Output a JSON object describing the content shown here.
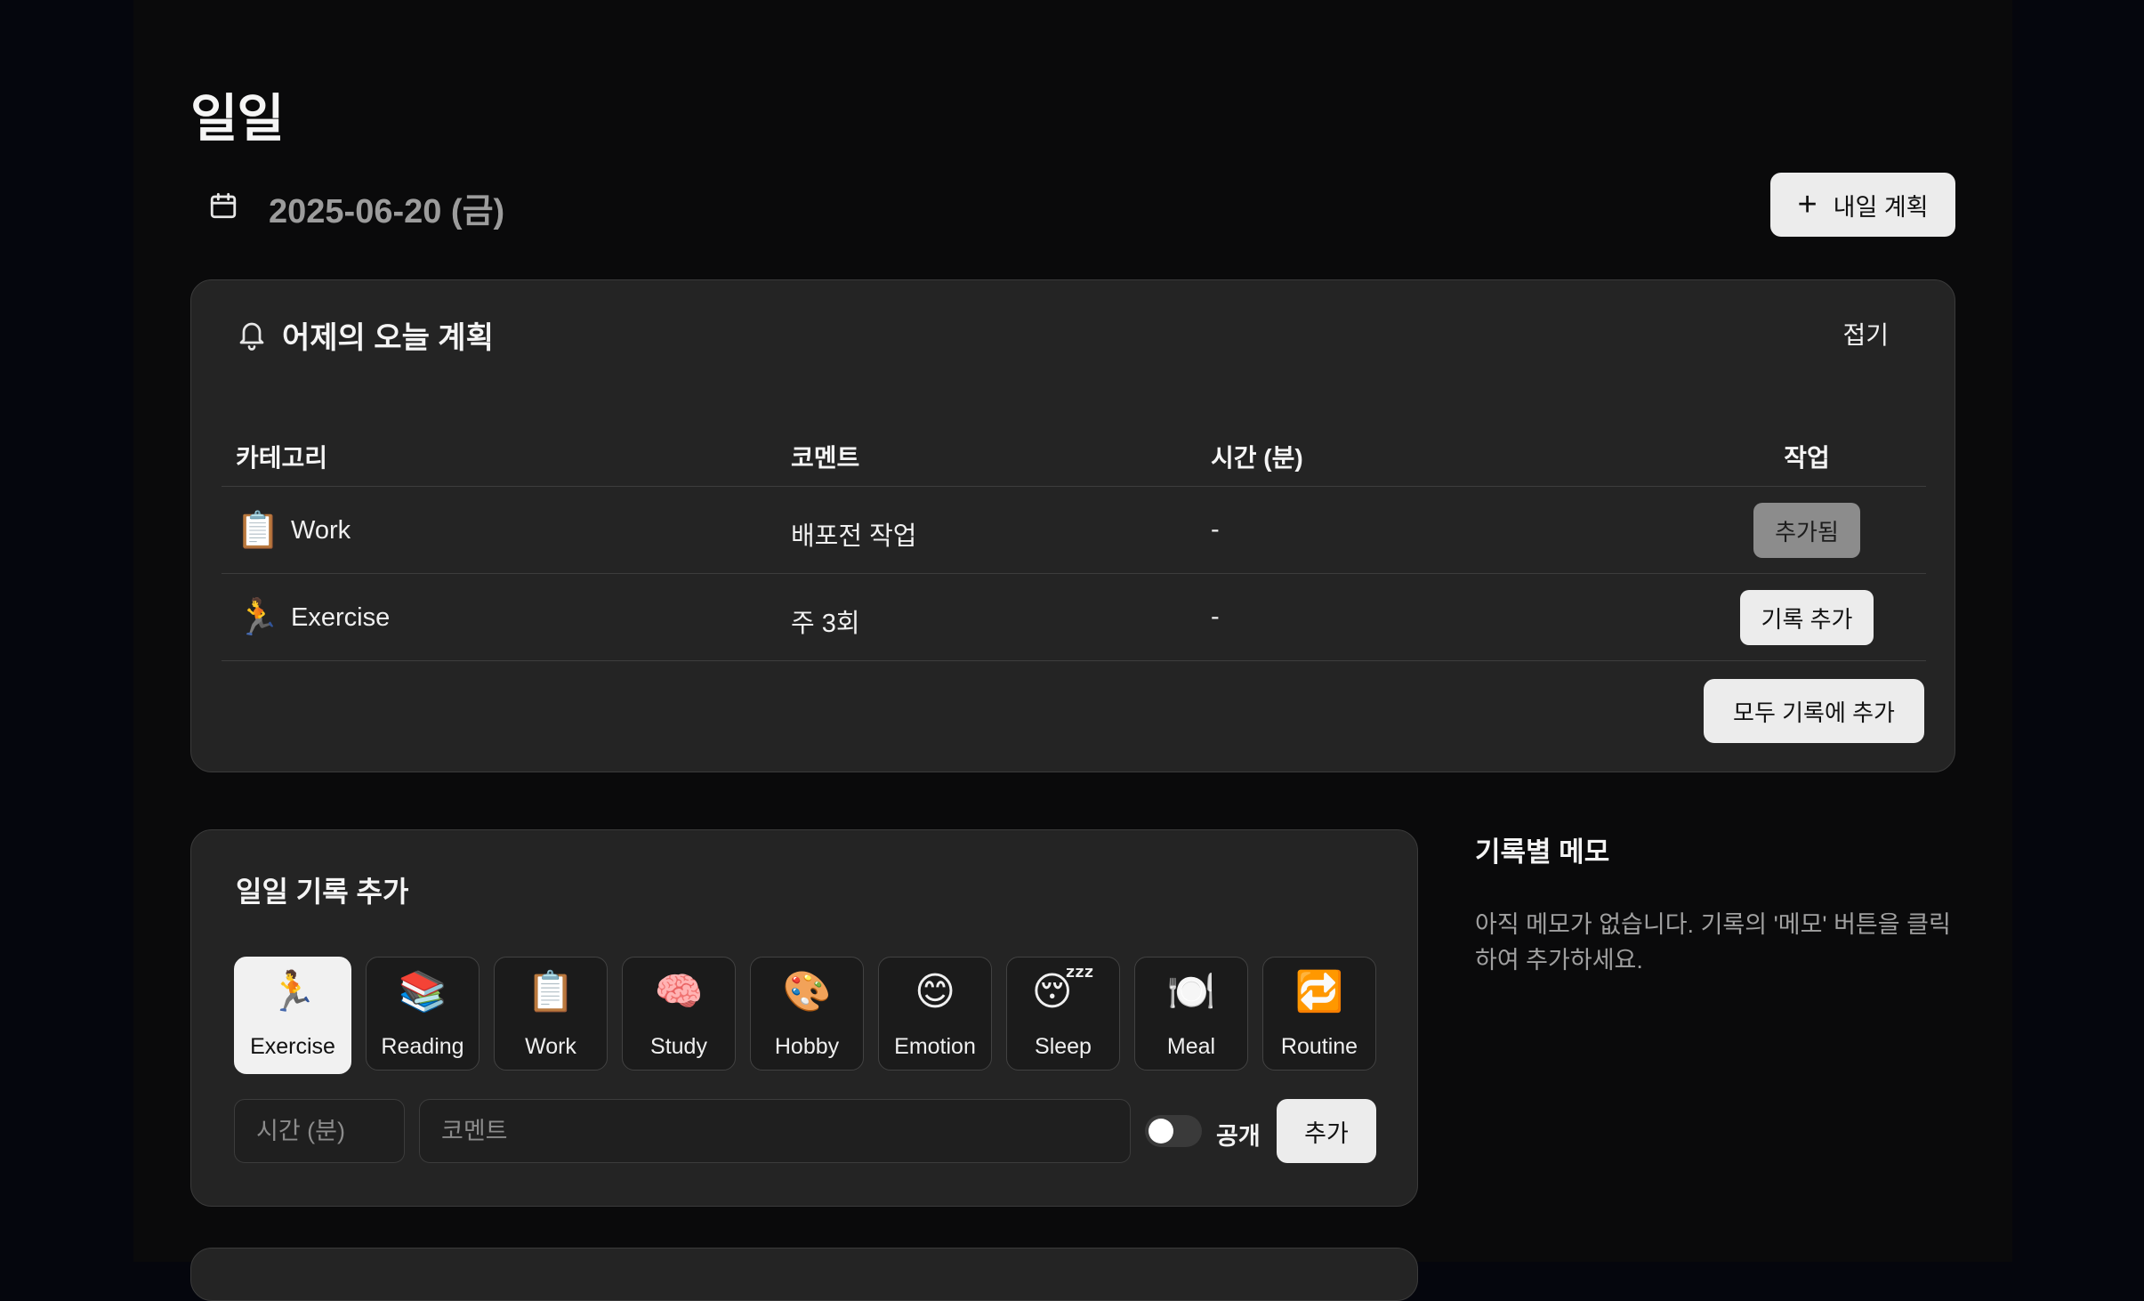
{
  "page": {
    "title": "일일",
    "date": "2025-06-20 (금)"
  },
  "header": {
    "tomorrow_plan_label": "내일 계획",
    "plus_icon": "plus-icon",
    "calendar_icon": "calendar-icon"
  },
  "plan": {
    "title": "어제의 오늘 계획",
    "bell_icon": "bell-icon",
    "collapse_label": "접기",
    "columns": {
      "category": "카테고리",
      "comment": "코멘트",
      "time": "시간 (분)",
      "action": "작업"
    },
    "rows": [
      {
        "emoji": "📋",
        "category": "Work",
        "comment": "배포전 작업",
        "time": "-",
        "action": "추가됨",
        "action_state": "added"
      },
      {
        "emoji": "🏃",
        "category": "Exercise",
        "comment": "주 3회",
        "time": "-",
        "action": "기록 추가",
        "action_state": "available"
      }
    ],
    "add_all_label": "모두 기록에 추가"
  },
  "add_record": {
    "title": "일일 기록 추가",
    "categories": [
      {
        "emoji": "🏃",
        "label": "Exercise",
        "selected": true
      },
      {
        "emoji": "📚",
        "label": "Reading",
        "selected": false
      },
      {
        "emoji": "📋",
        "label": "Work",
        "selected": false
      },
      {
        "emoji": "🧠",
        "label": "Study",
        "selected": false
      },
      {
        "emoji": "🎨",
        "label": "Hobby",
        "selected": false
      },
      {
        "emoji": "😊",
        "label": "Emotion",
        "selected": false
      },
      {
        "emoji": "😴",
        "label": "Sleep",
        "selected": false
      },
      {
        "emoji": "🍽️",
        "label": "Meal",
        "selected": false
      },
      {
        "emoji": "🔁",
        "label": "Routine",
        "selected": false
      }
    ],
    "time_placeholder": "시간 (분)",
    "comment_placeholder": "코멘트",
    "public_label": "공개",
    "public_enabled": false,
    "submit_label": "추가"
  },
  "memo": {
    "title": "기록별 메모",
    "empty_text": "아직 메모가 없습니다. 기록의 '메모' 버튼을 클릭하여 추가하세요."
  },
  "colors": {
    "background": "#0a0a0b",
    "card": "#242424",
    "button": "#ececec",
    "muted_text": "#9c9c9c"
  }
}
